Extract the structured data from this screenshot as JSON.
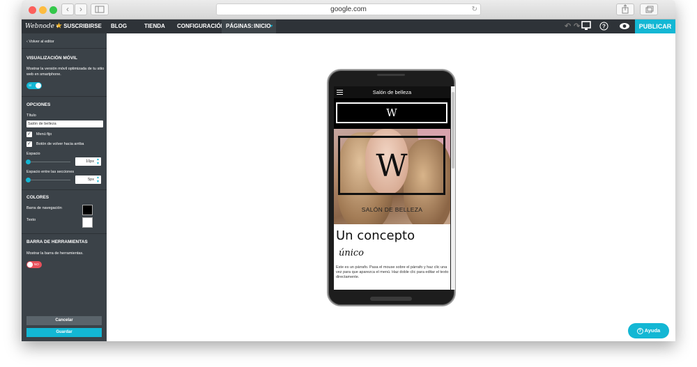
{
  "browser": {
    "url": "google.com"
  },
  "appbar": {
    "logo": "Webnode",
    "subscribe": "SUSCRIBIRSE",
    "nav": [
      "BLOG",
      "TIENDA",
      "CONFIGURACIÓN"
    ],
    "pages_label": "PÁGINAS:",
    "pages_value": "INICIO",
    "publish": "PUBLICAR"
  },
  "sidebar": {
    "back": "Volver al editor",
    "mobile_title": "VISUALIZACIÓN MÓVIL",
    "mobile_desc": "Mostrar la versión móvil optimizada de tu sitio web en smartphone.",
    "mobile_toggle": "SÍ",
    "options_title": "OPCIONES",
    "title_label": "Título",
    "title_value": "Salón de belleza",
    "fixed_menu": "Menú fijo",
    "back_top": "Botón de volver hacia arriba",
    "spacing_label": "Espacio",
    "spacing_value": "10px",
    "section_spacing_label": "Espacio entre las secciones",
    "section_spacing_value": "5px",
    "colors_title": "COLORES",
    "navbar_label": "Barra de navegación",
    "text_label": "Texto",
    "toolbar_title": "BARRA DE HERRAMIENTAS",
    "toolbar_desc": "Mostrar la barra de herramientas.",
    "toolbar_toggle": "NO",
    "cancel": "Cancelar",
    "save": "Guardar"
  },
  "mobile": {
    "nav_title": "Salón de belleza",
    "logo_letter": "W",
    "hero_letter": "W",
    "hero_caption": "SALÓN DE BELLEZA",
    "heading": "Un concepto",
    "script": "único",
    "paragraph": "Este es un párrafo. Pasa el mouse sobre el párrafo y haz clic una vez para que aparezca el menú. Haz doble clic para editar el texto directamente."
  },
  "help": "Ayuda",
  "colors": {
    "accent": "#13b7d4",
    "sidebar": "#3b4248",
    "topbar": "#2e3338",
    "toggle_off": "#e8505b"
  }
}
